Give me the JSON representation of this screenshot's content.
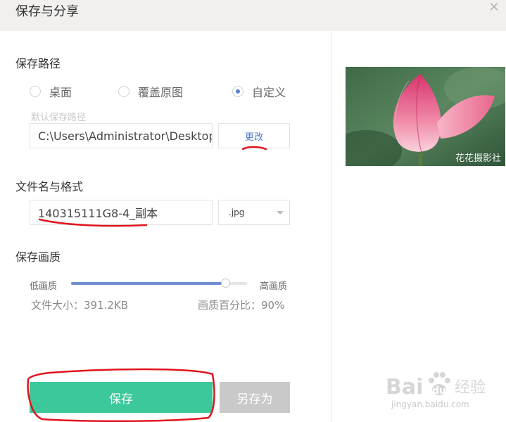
{
  "dialog": {
    "title": "保存与分享"
  },
  "save_path": {
    "label": "保存路径",
    "options": [
      {
        "label": "桌面",
        "checked": false
      },
      {
        "label": "覆盖原图",
        "checked": false
      },
      {
        "label": "自定义",
        "checked": true
      }
    ],
    "default_hint": "默认保存路径",
    "path_value": "C:\\Users\\Administrator\\Desktop",
    "change_label": "更改"
  },
  "file_name": {
    "label": "文件名与格式",
    "value": "140315111G8-4_副本",
    "format": ".jpg"
  },
  "quality": {
    "label": "保存画质",
    "low_label": "低画质",
    "high_label": "高画质",
    "level": 0.9,
    "file_size_text": "文件大小：391.2KB",
    "percent_text": "画质百分比：90%"
  },
  "buttons": {
    "save_label": "保存",
    "save_as_label": "另存为"
  },
  "preview": {
    "watermark": "花花摄影社"
  },
  "baidu_watermark": {
    "logo": "Bai",
    "logo2": "du",
    "suffix": "经验",
    "site": "jingyan.baidu.com"
  },
  "colors": {
    "accent": "#3cc89a",
    "link": "#4a78c6",
    "slider": "#6e8ecf",
    "annotation": "#e0141e"
  }
}
